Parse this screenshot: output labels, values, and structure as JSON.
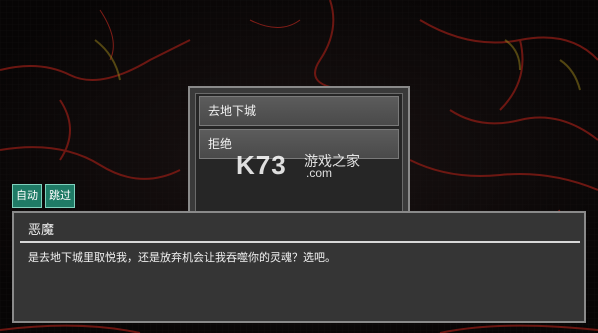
{
  "choices": {
    "items": [
      "去地下城",
      "拒绝"
    ]
  },
  "watermark": {
    "logo": "K73",
    "site_name": "游戏之家",
    "domain": ".com"
  },
  "controls": {
    "auto_label": "自动",
    "skip_label": "跳过"
  },
  "dialog": {
    "speaker": "恶魔",
    "text": "是去地下城里取悦我，还是放弃机会让我吞噬你的灵魂？选吧。"
  },
  "colors": {
    "lava": "#b3261e",
    "button_teal": "#1f7b66",
    "panel_gray": "#353535"
  }
}
